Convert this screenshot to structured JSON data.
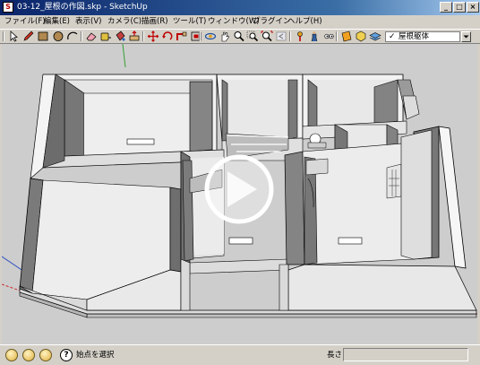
{
  "window": {
    "title": "03-12_屋根の作図.skp - SketchUp",
    "buttons": {
      "minimize": "_",
      "maximize": "□",
      "close": "×"
    }
  },
  "menu": [
    {
      "label": "ファイル(F)"
    },
    {
      "label": "編集(E)"
    },
    {
      "label": "表示(V)"
    },
    {
      "label": "カメラ(C)"
    },
    {
      "label": "描画(R)"
    },
    {
      "label": "ツール(T)"
    },
    {
      "label": "ウィンドウ(W)"
    },
    {
      "label": "プラグイン"
    },
    {
      "label": "ヘルプ(H)"
    }
  ],
  "toolbar": {
    "tools": [
      "select-arrow-icon",
      "pencil-icon",
      "rectangle-icon",
      "circle-icon",
      "arc-icon",
      "eraser-icon",
      "paint-bucket-icon",
      "push-pull-icon",
      "move-icon",
      "rotate-icon",
      "follow-me-icon",
      "orbit-icon",
      "pan-icon",
      "zoom-icon",
      "zoom-extents-icon",
      "previous-view-icon",
      "position-camera-icon",
      "walk-icon",
      "look-around-icon",
      "section-plane-icon",
      "components-icon",
      "styles-icon",
      "layers-icon"
    ],
    "scene_select": "屋根躯体",
    "scene_check": "✓"
  },
  "viewport": {
    "play_overlay": "play-icon"
  },
  "statusbar": {
    "hint": "始点を選択",
    "hint_icon": "?",
    "length_label": "長さ",
    "length_value": ""
  }
}
